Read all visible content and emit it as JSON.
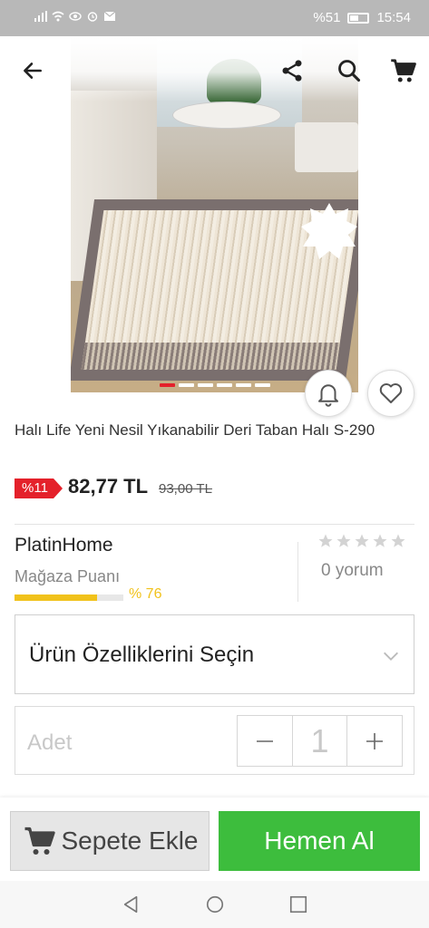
{
  "status_bar": {
    "battery": "%51",
    "time": "15:54"
  },
  "header": {
    "back_icon": "arrow-left-icon",
    "share_icon": "share-icon",
    "search_icon": "search-icon",
    "cart_icon": "cart-icon"
  },
  "gallery": {
    "image_count": 6,
    "active_index": 0
  },
  "product": {
    "title": "Halı Life Yeni Nesil Yıkanabilir Deri Taban Halı S-290",
    "discount_badge": "%11",
    "price": "82,77 TL",
    "old_price": "93,00 TL",
    "accent_color": "#e4212b"
  },
  "store": {
    "name": "PlatinHome",
    "score_label": "Mağaza Puanı",
    "score_value": "% 76",
    "score_fraction": 0.76,
    "review_count": "0 yorum",
    "rating_stars": 0
  },
  "options": {
    "select_label": "Ürün Özelliklerini Seçin"
  },
  "quantity": {
    "label": "Adet",
    "value": "1"
  },
  "actions": {
    "add_to_cart": "Sepete Ekle",
    "buy_now": "Hemen Al",
    "buy_color": "#3dbd3d"
  }
}
